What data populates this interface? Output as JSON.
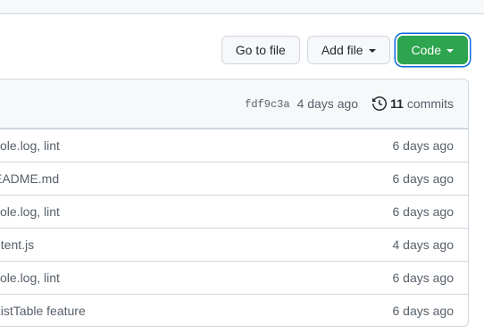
{
  "toolbar": {
    "go_to_file": "Go to file",
    "add_file": "Add file",
    "code": "Code"
  },
  "header": {
    "sha": "fdf9c3a",
    "ago": "4 days ago",
    "commit_count": "11",
    "commits_label": "commits"
  },
  "rows": [
    {
      "message": "sole.log, lint",
      "date": "6 days ago"
    },
    {
      "message": "EADME.md",
      "date": "6 days ago"
    },
    {
      "message": "sole.log, lint",
      "date": "6 days ago"
    },
    {
      "message": "ntent.js",
      "date": "4 days ago"
    },
    {
      "message": "sole.log, lint",
      "date": "6 days ago"
    },
    {
      "message": "ListTable feature",
      "date": "6 days ago"
    }
  ],
  "colors": {
    "primary": "#2da44e",
    "focus": "#0969da",
    "border": "#d0d7de"
  },
  "icons": [
    "caret-down-icon",
    "history-icon"
  ]
}
